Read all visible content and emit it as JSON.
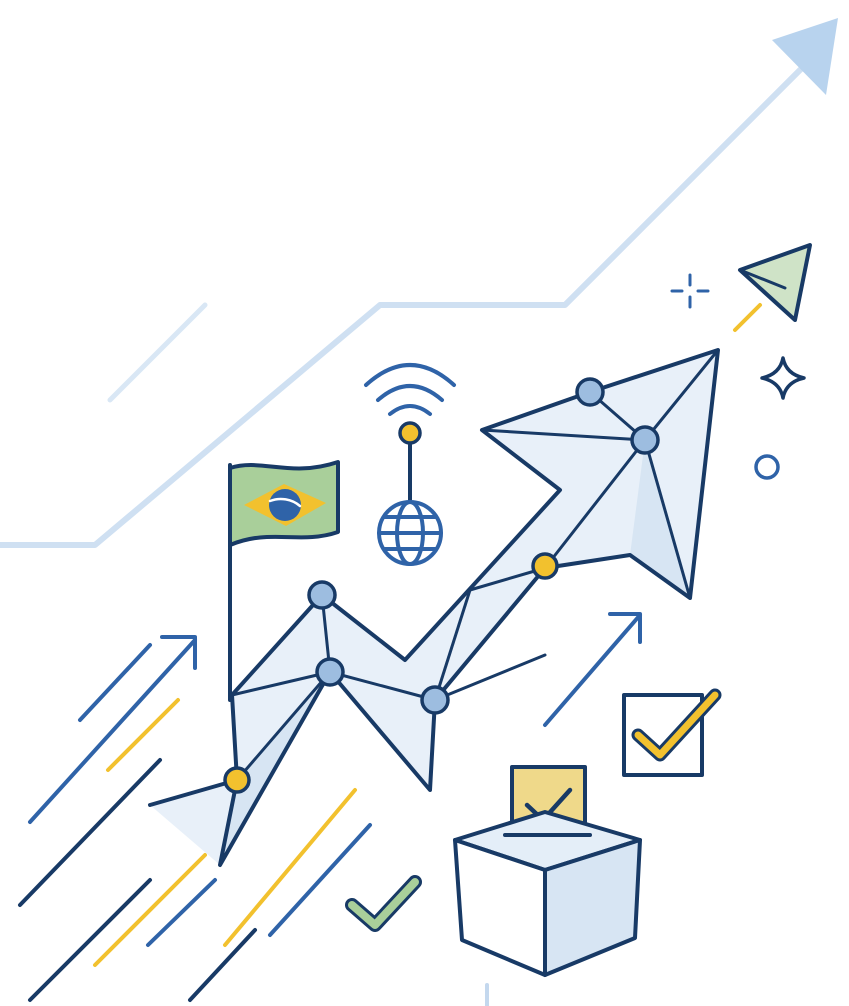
{
  "title": "",
  "colors": {
    "navy": "#183a66",
    "blue": "#2f63a8",
    "light_blue": "#a9c8e6",
    "pale_blue": "#e4eef8",
    "node_blue": "#9dbde0",
    "yellow": "#f2c12e",
    "green": "#6fa36f",
    "pale_green": "#cfe3c7",
    "pale_yellow": "#efd98a",
    "faint_line": "#cfdff0"
  },
  "icons": [
    "background-arrow-icon",
    "network-arrow-icon",
    "brazil-flag-icon",
    "globe-icon",
    "wifi-signal-icon",
    "paper-plane-icon",
    "sparkle-icon",
    "circle-icon",
    "checkbox-checked-icon",
    "ballot-box-icon",
    "checkmark-icon",
    "speed-lines-icon"
  ]
}
